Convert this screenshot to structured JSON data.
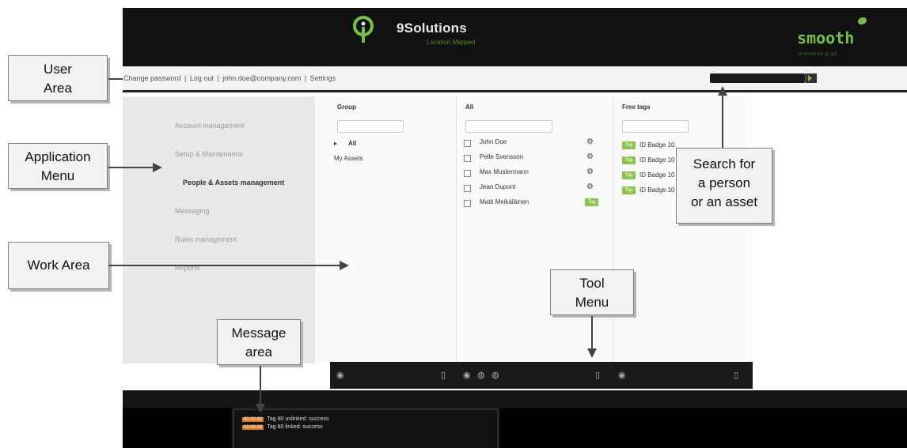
{
  "header": {
    "logo_icon": "location-pin-icon",
    "brand_title": "9Solutions",
    "brand_subtitle": "Location Mapped",
    "partner_logo": "smooth",
    "accent": "#76c043"
  },
  "user_area": {
    "links": [
      "Change password",
      "Log out",
      "john.doe@company.com",
      "Settings"
    ],
    "separator": " | ",
    "search_placeholder": ""
  },
  "app_menu": {
    "items": [
      {
        "label": "Account management",
        "active": false
      },
      {
        "label": "Setup & Maintenance",
        "active": false
      },
      {
        "label": "People & Assets management",
        "active": true
      },
      {
        "label": "Messaging",
        "active": false
      },
      {
        "label": "Rules management",
        "active": false
      },
      {
        "label": "Reports",
        "active": false
      }
    ]
  },
  "work": {
    "group_column": {
      "header": "Group",
      "rows": [
        "All",
        "My Assets"
      ]
    },
    "all_column": {
      "header": "All",
      "people": [
        {
          "name": "John Doe",
          "action": "gear"
        },
        {
          "name": "Pelle Svensson",
          "action": "gear"
        },
        {
          "name": "Max Mustermann",
          "action": "gear"
        },
        {
          "name": "Jean Dupont",
          "action": "gear"
        },
        {
          "name": "Matti Meikäläinen",
          "action": "tag",
          "tag_label": "Tag"
        }
      ]
    },
    "free_tags_column": {
      "header": "Free tags",
      "tags": [
        {
          "badge": "Tag",
          "name": "ID Badge 10"
        },
        {
          "badge": "Tag",
          "name": "ID Badge 10"
        },
        {
          "badge": "Tag",
          "name": "ID Badge 10"
        },
        {
          "badge": "Tag",
          "name": "ID Badge 10"
        }
      ]
    }
  },
  "messages": [
    {
      "time": "00:00:00",
      "text": "Tag 80 unlinked: success"
    },
    {
      "time": "00:00:00",
      "text": "Tag 80 linked: success"
    }
  ],
  "callouts": {
    "user_area": [
      "User",
      "Area"
    ],
    "application_menu": [
      "Application",
      "Menu"
    ],
    "work_area": [
      "Work Area"
    ],
    "message_area": [
      "Message",
      "area"
    ],
    "tool_menu": [
      "Tool",
      "Menu"
    ],
    "search": [
      "Search for",
      "a person",
      "or an asset"
    ]
  }
}
